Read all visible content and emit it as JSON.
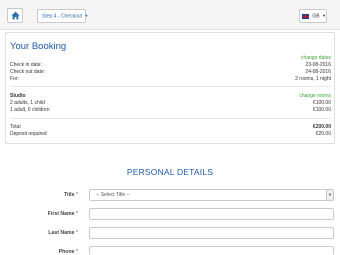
{
  "topbar": {
    "step_label": "Step 4 - Checkout",
    "language": "GB"
  },
  "booking": {
    "title": "Your Booking",
    "change_dates": "change dates",
    "checkin_label": "Check in date:",
    "checkin_value": "23-08-2016",
    "checkout_label": "Check out date:",
    "checkout_value": "24-08-2016",
    "for_label": "For:",
    "for_value": "2 rooms, 1 night",
    "room_name": "Studio",
    "change_rooms": "change rooms",
    "rooms": [
      {
        "occupancy": "2 adults, 1 child",
        "price": "€100.00"
      },
      {
        "occupancy": "1 adult, 0 children",
        "price": "€100.00"
      }
    ],
    "total_label": "Total",
    "total_value": "€200.00",
    "deposit_label": "Deposit required",
    "deposit_value": "€20.00"
  },
  "personal": {
    "title": "PERSONAL DETAILS",
    "required_mark": "*",
    "title_label": "Title",
    "title_select": "-- Select Title --",
    "first_name_label": "First Name",
    "last_name_label": "Last Name",
    "phone_label": "Phone"
  },
  "colors": {
    "accent_blue": "#1f5aa6",
    "link_green": "#3aa335"
  },
  "icons": {
    "home": "home-icon",
    "flag": "uk-flag-icon",
    "caret": "caret-down-icon"
  }
}
